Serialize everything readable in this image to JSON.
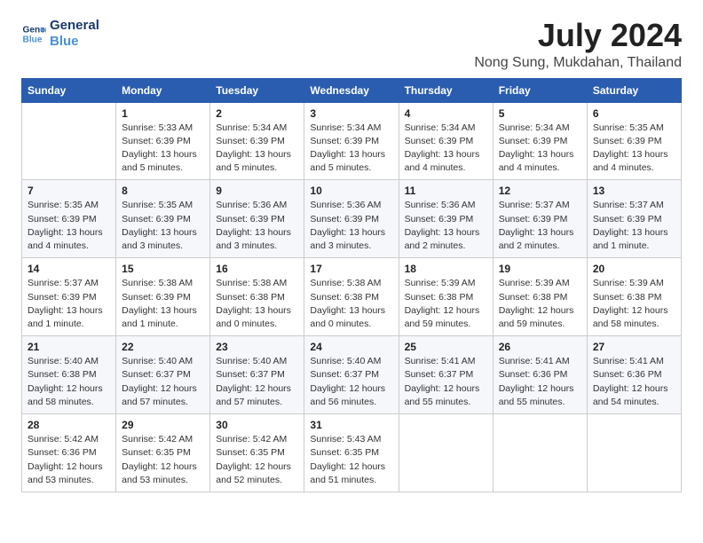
{
  "logo": {
    "line1": "General",
    "line2": "Blue"
  },
  "title": "July 2024",
  "location": "Nong Sung, Mukdahan, Thailand",
  "weekdays": [
    "Sunday",
    "Monday",
    "Tuesday",
    "Wednesday",
    "Thursday",
    "Friday",
    "Saturday"
  ],
  "weeks": [
    [
      {
        "day": "",
        "info": ""
      },
      {
        "day": "1",
        "info": "Sunrise: 5:33 AM\nSunset: 6:39 PM\nDaylight: 13 hours\nand 5 minutes."
      },
      {
        "day": "2",
        "info": "Sunrise: 5:34 AM\nSunset: 6:39 PM\nDaylight: 13 hours\nand 5 minutes."
      },
      {
        "day": "3",
        "info": "Sunrise: 5:34 AM\nSunset: 6:39 PM\nDaylight: 13 hours\nand 5 minutes."
      },
      {
        "day": "4",
        "info": "Sunrise: 5:34 AM\nSunset: 6:39 PM\nDaylight: 13 hours\nand 4 minutes."
      },
      {
        "day": "5",
        "info": "Sunrise: 5:34 AM\nSunset: 6:39 PM\nDaylight: 13 hours\nand 4 minutes."
      },
      {
        "day": "6",
        "info": "Sunrise: 5:35 AM\nSunset: 6:39 PM\nDaylight: 13 hours\nand 4 minutes."
      }
    ],
    [
      {
        "day": "7",
        "info": "Sunrise: 5:35 AM\nSunset: 6:39 PM\nDaylight: 13 hours\nand 4 minutes."
      },
      {
        "day": "8",
        "info": "Sunrise: 5:35 AM\nSunset: 6:39 PM\nDaylight: 13 hours\nand 3 minutes."
      },
      {
        "day": "9",
        "info": "Sunrise: 5:36 AM\nSunset: 6:39 PM\nDaylight: 13 hours\nand 3 minutes."
      },
      {
        "day": "10",
        "info": "Sunrise: 5:36 AM\nSunset: 6:39 PM\nDaylight: 13 hours\nand 3 minutes."
      },
      {
        "day": "11",
        "info": "Sunrise: 5:36 AM\nSunset: 6:39 PM\nDaylight: 13 hours\nand 2 minutes."
      },
      {
        "day": "12",
        "info": "Sunrise: 5:37 AM\nSunset: 6:39 PM\nDaylight: 13 hours\nand 2 minutes."
      },
      {
        "day": "13",
        "info": "Sunrise: 5:37 AM\nSunset: 6:39 PM\nDaylight: 13 hours\nand 1 minute."
      }
    ],
    [
      {
        "day": "14",
        "info": "Sunrise: 5:37 AM\nSunset: 6:39 PM\nDaylight: 13 hours\nand 1 minute."
      },
      {
        "day": "15",
        "info": "Sunrise: 5:38 AM\nSunset: 6:39 PM\nDaylight: 13 hours\nand 1 minute."
      },
      {
        "day": "16",
        "info": "Sunrise: 5:38 AM\nSunset: 6:38 PM\nDaylight: 13 hours\nand 0 minutes."
      },
      {
        "day": "17",
        "info": "Sunrise: 5:38 AM\nSunset: 6:38 PM\nDaylight: 13 hours\nand 0 minutes."
      },
      {
        "day": "18",
        "info": "Sunrise: 5:39 AM\nSunset: 6:38 PM\nDaylight: 12 hours\nand 59 minutes."
      },
      {
        "day": "19",
        "info": "Sunrise: 5:39 AM\nSunset: 6:38 PM\nDaylight: 12 hours\nand 59 minutes."
      },
      {
        "day": "20",
        "info": "Sunrise: 5:39 AM\nSunset: 6:38 PM\nDaylight: 12 hours\nand 58 minutes."
      }
    ],
    [
      {
        "day": "21",
        "info": "Sunrise: 5:40 AM\nSunset: 6:38 PM\nDaylight: 12 hours\nand 58 minutes."
      },
      {
        "day": "22",
        "info": "Sunrise: 5:40 AM\nSunset: 6:37 PM\nDaylight: 12 hours\nand 57 minutes."
      },
      {
        "day": "23",
        "info": "Sunrise: 5:40 AM\nSunset: 6:37 PM\nDaylight: 12 hours\nand 57 minutes."
      },
      {
        "day": "24",
        "info": "Sunrise: 5:40 AM\nSunset: 6:37 PM\nDaylight: 12 hours\nand 56 minutes."
      },
      {
        "day": "25",
        "info": "Sunrise: 5:41 AM\nSunset: 6:37 PM\nDaylight: 12 hours\nand 55 minutes."
      },
      {
        "day": "26",
        "info": "Sunrise: 5:41 AM\nSunset: 6:36 PM\nDaylight: 12 hours\nand 55 minutes."
      },
      {
        "day": "27",
        "info": "Sunrise: 5:41 AM\nSunset: 6:36 PM\nDaylight: 12 hours\nand 54 minutes."
      }
    ],
    [
      {
        "day": "28",
        "info": "Sunrise: 5:42 AM\nSunset: 6:36 PM\nDaylight: 12 hours\nand 53 minutes."
      },
      {
        "day": "29",
        "info": "Sunrise: 5:42 AM\nSunset: 6:35 PM\nDaylight: 12 hours\nand 53 minutes."
      },
      {
        "day": "30",
        "info": "Sunrise: 5:42 AM\nSunset: 6:35 PM\nDaylight: 12 hours\nand 52 minutes."
      },
      {
        "day": "31",
        "info": "Sunrise: 5:43 AM\nSunset: 6:35 PM\nDaylight: 12 hours\nand 51 minutes."
      },
      {
        "day": "",
        "info": ""
      },
      {
        "day": "",
        "info": ""
      },
      {
        "day": "",
        "info": ""
      }
    ]
  ]
}
